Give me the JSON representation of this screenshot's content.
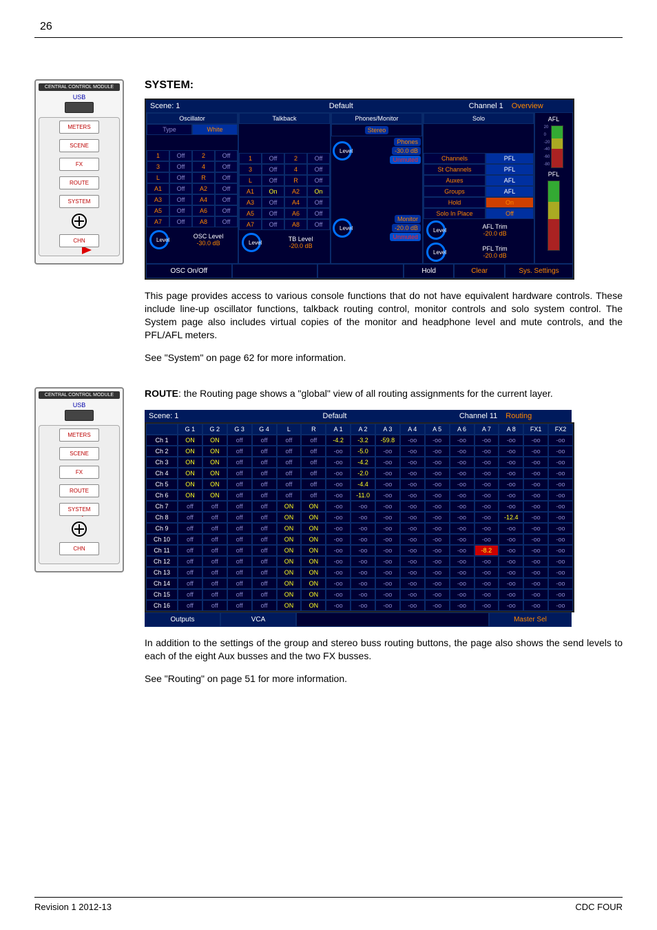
{
  "page_number": "26",
  "footer_left": "Revision 1 2012-13",
  "footer_right": "CDC FOUR",
  "module": {
    "title": "CENTRAL CONTROL MODULE",
    "usb_label": "USB",
    "buttons": [
      "METERS",
      "SCENE",
      "FX",
      "ROUTE",
      "SYSTEM",
      "CHN"
    ]
  },
  "section1": {
    "heading": "SYSTEM:",
    "body1": "This page provides access to various console functions that do not have equivalent hardware controls. These include line-up oscillator functions, talkback routing control, monitor controls and solo system control. The System page also includes virtual copies of the monitor and headphone level and mute controls, and the PFL/AFL meters.",
    "body2": "See \"System\" on page 62 for more information."
  },
  "section2": {
    "heading_bold": "ROUTE",
    "heading_rest": ": the Routing page shows a \"global\" view of all routing assignments for the current layer.",
    "body1": "In addition to the settings of the group and stereo buss routing buttons, the page also shows the send levels to each of the eight Aux busses and the two FX busses.",
    "body2": "See \"Routing\" on page 51 for more information."
  },
  "system_ss": {
    "titlebar": [
      "Scene: 1",
      "Default",
      "Channel 1",
      "Overview"
    ],
    "sections": {
      "osc": {
        "title": "Oscillator",
        "subhead_left": "Type",
        "subhead_right": "White",
        "rows": [
          [
            "1",
            "Off",
            "2",
            "Off"
          ],
          [
            "3",
            "Off",
            "4",
            "Off"
          ],
          [
            "L",
            "Off",
            "R",
            "Off"
          ],
          [
            "A1",
            "Off",
            "A2",
            "Off"
          ],
          [
            "A3",
            "Off",
            "A4",
            "Off"
          ],
          [
            "A5",
            "Off",
            "A6",
            "Off"
          ],
          [
            "A7",
            "Off",
            "A8",
            "Off"
          ]
        ],
        "level_label": "OSC Level",
        "level_db": "-30.0 dB",
        "level_knob": "Level"
      },
      "tb": {
        "title": "Talkback",
        "rows": [
          [
            "1",
            "Off",
            "2",
            "Off"
          ],
          [
            "3",
            "Off",
            "4",
            "Off"
          ],
          [
            "L",
            "Off",
            "R",
            "Off"
          ],
          [
            "A1",
            "On",
            "A2",
            "On"
          ],
          [
            "A3",
            "Off",
            "A4",
            "Off"
          ],
          [
            "A5",
            "Off",
            "A6",
            "Off"
          ],
          [
            "A7",
            "Off",
            "A8",
            "Off"
          ]
        ],
        "level_label": "TB Level",
        "level_db": "-20.0 dB",
        "level_knob": "Level"
      },
      "pm": {
        "title": "Phones/Monitor",
        "stereo": "Stereo",
        "phones_lbl": "Phones",
        "phones_db": "-30.0 dB",
        "phones_mute": "Unmuted",
        "mon_lbl": "Monitor",
        "mon_db": "-20.0 dB",
        "mon_mute": "Unmuted",
        "level_knob": "Level"
      },
      "solo": {
        "title": "Solo",
        "rows": [
          [
            "Channels",
            "PFL"
          ],
          [
            "St Channels",
            "PFL"
          ],
          [
            "Auxes",
            "AFL"
          ],
          [
            "Groups",
            "AFL"
          ],
          [
            "Hold",
            "On"
          ],
          [
            "Solo In Place",
            "Off"
          ]
        ],
        "afl_trim_lbl": "AFL Trim",
        "afl_trim_db": "-20.0 dB",
        "pfl_trim_lbl": "PFL Trim",
        "pfl_trim_db": "-20.0 dB",
        "level_knob": "Level"
      },
      "afl_meter_label": "AFL",
      "pfl_meter_label": "PFL",
      "meter_ticks": [
        "20",
        "0",
        "-20",
        "-40",
        "-60",
        "-80"
      ]
    },
    "bottom": [
      "OSC On/Off",
      "",
      "",
      "Hold",
      "Clear",
      "Sys. Settings"
    ]
  },
  "route_ss": {
    "titlebar": [
      "Scene: 1",
      "Default",
      "Channel 11",
      "Routing"
    ],
    "columns": [
      "",
      "G 1",
      "G 2",
      "G 3",
      "G 4",
      "L",
      "R",
      "A 1",
      "A 2",
      "A 3",
      "A 4",
      "A 5",
      "A 6",
      "A 7",
      "A 8",
      "FX1",
      "FX2"
    ],
    "rows": [
      {
        "ch": "Ch 1",
        "g": [
          "ON",
          "ON",
          "off",
          "off",
          "off",
          "off"
        ],
        "a": [
          "-4.2",
          "-3.2",
          "-59.8",
          "-oo",
          "-oo",
          "-oo",
          "-oo",
          "-oo",
          "-oo",
          "-oo"
        ]
      },
      {
        "ch": "Ch 2",
        "g": [
          "ON",
          "ON",
          "off",
          "off",
          "off",
          "off"
        ],
        "a": [
          "-oo",
          "-5.0",
          "-oo",
          "-oo",
          "-oo",
          "-oo",
          "-oo",
          "-oo",
          "-oo",
          "-oo"
        ]
      },
      {
        "ch": "Ch 3",
        "g": [
          "ON",
          "ON",
          "off",
          "off",
          "off",
          "off"
        ],
        "a": [
          "-oo",
          "-4.2",
          "-oo",
          "-oo",
          "-oo",
          "-oo",
          "-oo",
          "-oo",
          "-oo",
          "-oo"
        ]
      },
      {
        "ch": "Ch 4",
        "g": [
          "ON",
          "ON",
          "off",
          "off",
          "off",
          "off"
        ],
        "a": [
          "-oo",
          "-2.0",
          "-oo",
          "-oo",
          "-oo",
          "-oo",
          "-oo",
          "-oo",
          "-oo",
          "-oo"
        ]
      },
      {
        "ch": "Ch 5",
        "g": [
          "ON",
          "ON",
          "off",
          "off",
          "off",
          "off"
        ],
        "a": [
          "-oo",
          "-4.4",
          "-oo",
          "-oo",
          "-oo",
          "-oo",
          "-oo",
          "-oo",
          "-oo",
          "-oo"
        ]
      },
      {
        "ch": "Ch 6",
        "g": [
          "ON",
          "ON",
          "off",
          "off",
          "off",
          "off"
        ],
        "a": [
          "-oo",
          "-11.0",
          "-oo",
          "-oo",
          "-oo",
          "-oo",
          "-oo",
          "-oo",
          "-oo",
          "-oo"
        ]
      },
      {
        "ch": "Ch 7",
        "g": [
          "off",
          "off",
          "off",
          "off",
          "ON",
          "ON"
        ],
        "a": [
          "-oo",
          "-oo",
          "-oo",
          "-oo",
          "-oo",
          "-oo",
          "-oo",
          "-oo",
          "-oo",
          "-oo"
        ]
      },
      {
        "ch": "Ch 8",
        "g": [
          "off",
          "off",
          "off",
          "off",
          "ON",
          "ON"
        ],
        "a": [
          "-oo",
          "-oo",
          "-oo",
          "-oo",
          "-oo",
          "-oo",
          "-oo",
          "-12.4",
          "-oo",
          "-oo"
        ]
      },
      {
        "ch": "Ch 9",
        "g": [
          "off",
          "off",
          "off",
          "off",
          "ON",
          "ON"
        ],
        "a": [
          "-oo",
          "-oo",
          "-oo",
          "-oo",
          "-oo",
          "-oo",
          "-oo",
          "-oo",
          "-oo",
          "-oo"
        ]
      },
      {
        "ch": "Ch 10",
        "g": [
          "off",
          "off",
          "off",
          "off",
          "ON",
          "ON"
        ],
        "a": [
          "-oo",
          "-oo",
          "-oo",
          "-oo",
          "-oo",
          "-oo",
          "-oo",
          "-oo",
          "-oo",
          "-oo"
        ]
      },
      {
        "ch": "Ch 11",
        "g": [
          "off",
          "off",
          "off",
          "off",
          "ON",
          "ON"
        ],
        "a": [
          "-oo",
          "-oo",
          "-oo",
          "-oo",
          "-oo",
          "-oo",
          "-8.2",
          "-oo",
          "-oo",
          "-oo"
        ],
        "hilite": 6
      },
      {
        "ch": "Ch 12",
        "g": [
          "off",
          "off",
          "off",
          "off",
          "ON",
          "ON"
        ],
        "a": [
          "-oo",
          "-oo",
          "-oo",
          "-oo",
          "-oo",
          "-oo",
          "-oo",
          "-oo",
          "-oo",
          "-oo"
        ]
      },
      {
        "ch": "Ch 13",
        "g": [
          "off",
          "off",
          "off",
          "off",
          "ON",
          "ON"
        ],
        "a": [
          "-oo",
          "-oo",
          "-oo",
          "-oo",
          "-oo",
          "-oo",
          "-oo",
          "-oo",
          "-oo",
          "-oo"
        ]
      },
      {
        "ch": "Ch 14",
        "g": [
          "off",
          "off",
          "off",
          "off",
          "ON",
          "ON"
        ],
        "a": [
          "-oo",
          "-oo",
          "-oo",
          "-oo",
          "-oo",
          "-oo",
          "-oo",
          "-oo",
          "-oo",
          "-oo"
        ]
      },
      {
        "ch": "Ch 15",
        "g": [
          "off",
          "off",
          "off",
          "off",
          "ON",
          "ON"
        ],
        "a": [
          "-oo",
          "-oo",
          "-oo",
          "-oo",
          "-oo",
          "-oo",
          "-oo",
          "-oo",
          "-oo",
          "-oo"
        ]
      },
      {
        "ch": "Ch 16",
        "g": [
          "off",
          "off",
          "off",
          "off",
          "ON",
          "ON"
        ],
        "a": [
          "-oo",
          "-oo",
          "-oo",
          "-oo",
          "-oo",
          "-oo",
          "-oo",
          "-oo",
          "-oo",
          "-oo"
        ]
      }
    ],
    "bottom": [
      "Outputs",
      "VCA",
      "",
      "Master Sel"
    ]
  }
}
